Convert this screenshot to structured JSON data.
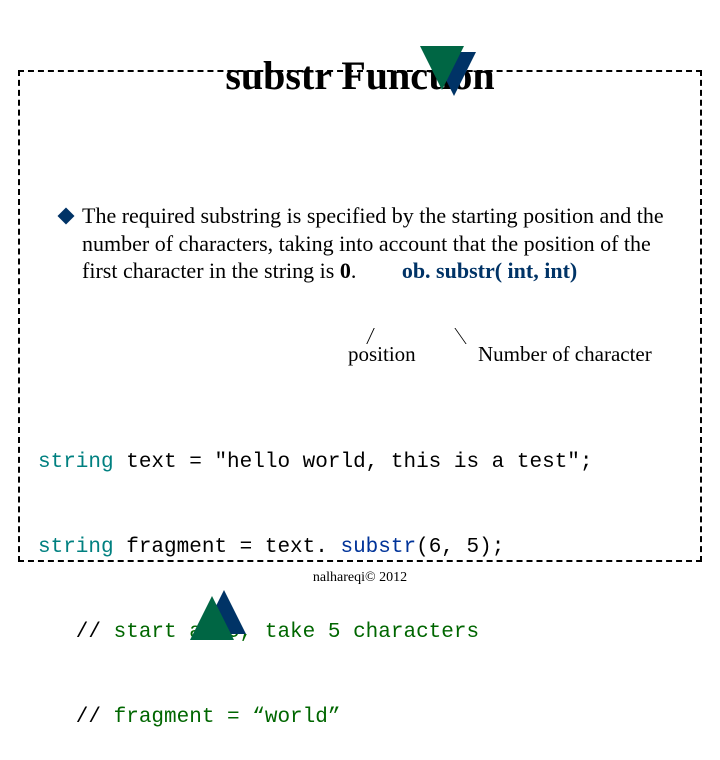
{
  "title": {
    "bold": "substr",
    "rest": " Function"
  },
  "bullet": {
    "text_prefix": "The required substring is specified by the starting position and the number of characters, taking into account that the position of the first character in the string is ",
    "zero": "0",
    "dot": ".",
    "signature": "ob. substr( int, int)"
  },
  "annotations": {
    "position": "position",
    "number": "Number of character"
  },
  "code": {
    "l1_kw": "string",
    "l1_rest": " text = \"hello world, this is a test\";",
    "l2_kw": "string",
    "l2_mid": " fragment = text. ",
    "l2_call": "substr",
    "l2_args": "(6, 5);",
    "l3_cm": "   // ",
    "l3_txt": "start at 6, take 5 characters",
    "l4_cm": "   // ",
    "l4_txt": "fragment = “world”"
  },
  "footer": "nalhareqi© 2012"
}
